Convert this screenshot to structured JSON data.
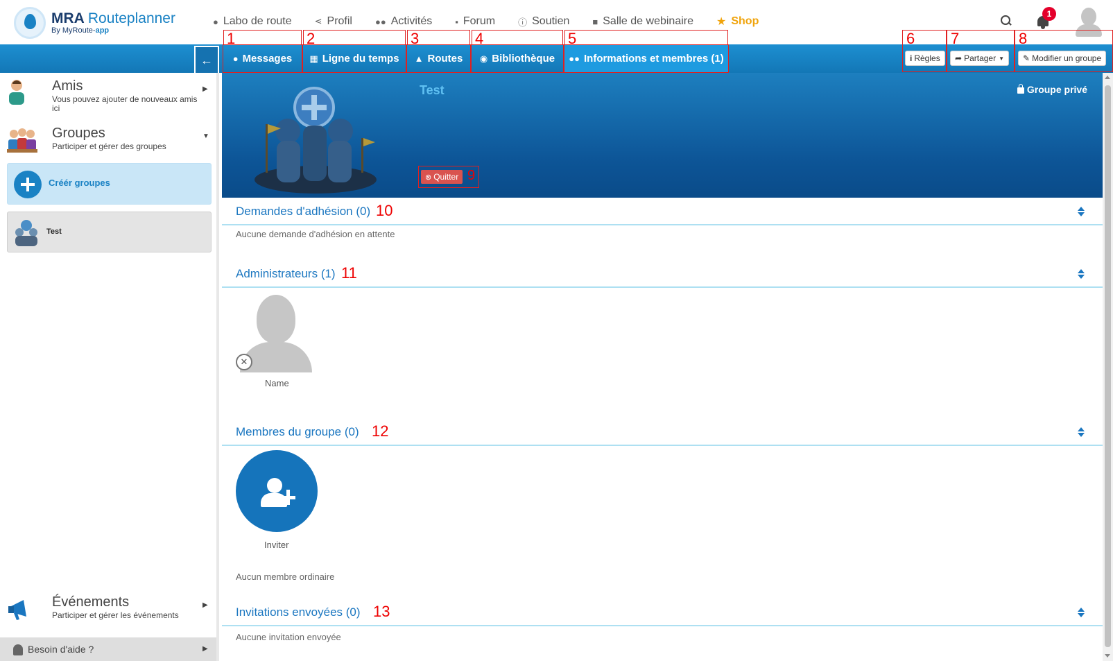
{
  "app": {
    "logo_title_bold": "MRA",
    "logo_title_light": "Routeplanner",
    "logo_sub_prefix": "By MyRoute-",
    "logo_sub_bold": "app",
    "brand_color": "#1a82c4"
  },
  "topnav": {
    "items": [
      {
        "label": "Labo de route",
        "icon": "map-marker-icon"
      },
      {
        "label": "Profil",
        "icon": "share-icon"
      },
      {
        "label": "Activités",
        "icon": "users-icon"
      },
      {
        "label": "Forum",
        "icon": "comments-icon"
      },
      {
        "label": "Soutien",
        "icon": "info-circle-icon"
      },
      {
        "label": "Salle de webinaire",
        "icon": "video-camera-icon"
      },
      {
        "label": "Shop",
        "icon": "star-icon"
      }
    ],
    "notification_count": "1"
  },
  "tabs": [
    {
      "num": "1",
      "label": "Messages",
      "icon": "comments-icon",
      "active": false
    },
    {
      "num": "2",
      "label": "Ligne du temps",
      "icon": "calendar-icon",
      "active": false
    },
    {
      "num": "3",
      "label": "Routes",
      "icon": "road-icon",
      "active": false
    },
    {
      "num": "4",
      "label": "Bibliothèque",
      "icon": "globe-icon",
      "active": false
    },
    {
      "num": "5",
      "label": "Informations et membres (1)",
      "icon": "users-icon",
      "active": true
    }
  ],
  "right_buttons": [
    {
      "num": "6",
      "label": "Règles",
      "icon": "info-icon"
    },
    {
      "num": "7",
      "label": "Partager",
      "icon": "share-icon"
    },
    {
      "num": "8",
      "label": "Modifier un groupe",
      "icon": "edit-icon"
    }
  ],
  "sidebar": {
    "friends": {
      "title": "Amis",
      "subtitle": "Vous pouvez ajouter de nouveaux amis ici"
    },
    "groups": {
      "title": "Groupes",
      "subtitle": "Participer et gérer des groupes"
    },
    "create_label": "Créér groupes",
    "group_item": "Test",
    "events": {
      "title": "Événements",
      "subtitle": "Participer et gérer les événements"
    },
    "help_label": "Besoin d'aide ?"
  },
  "group": {
    "name": "Test",
    "privacy": "Groupe privé",
    "quit_label": "Quitter",
    "quit_num": "9"
  },
  "sections": {
    "requests": {
      "title": "Demandes d'adhésion (0)",
      "num": "10",
      "empty": "Aucune demande d'adhésion en attente"
    },
    "admins": {
      "title": "Administrateurs (1)",
      "num": "11",
      "member_name": "Name"
    },
    "members": {
      "title": "Membres du groupe (0)",
      "num": "12",
      "invite_label": "Inviter",
      "empty": "Aucun membre ordinaire"
    },
    "invitations": {
      "title": "Invitations envoyées (0)",
      "num": "13",
      "empty": "Aucune invitation envoyée"
    }
  }
}
